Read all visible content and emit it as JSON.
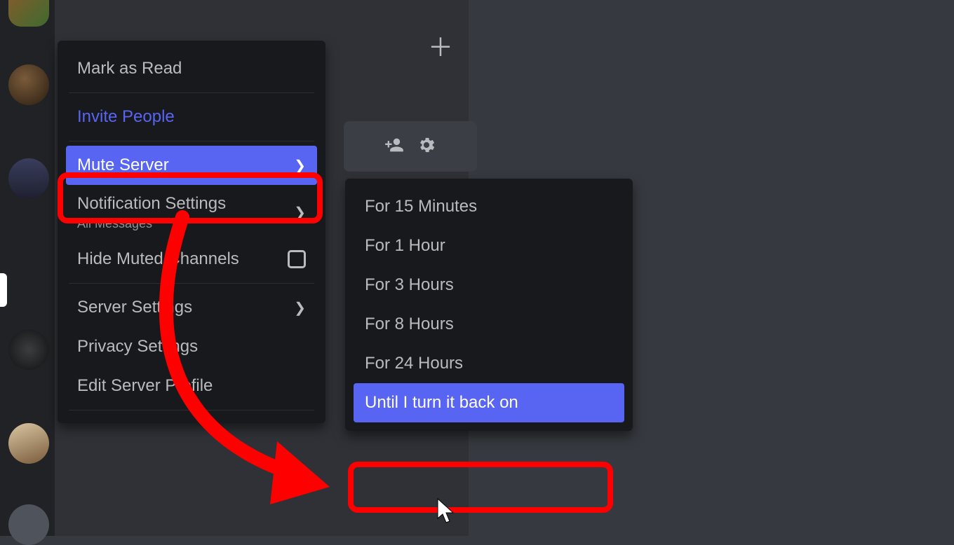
{
  "menu": {
    "mark_as_read": "Mark as Read",
    "invite_people": "Invite People",
    "mute_server": "Mute Server",
    "notification_settings": "Notification Settings",
    "notification_sub": "All Messages",
    "hide_muted_channels": "Hide Muted Channels",
    "server_settings": "Server Settings",
    "privacy_settings": "Privacy Settings",
    "edit_server_profile": "Edit Server Profile"
  },
  "mute_options": {
    "opt_15m": "For 15 Minutes",
    "opt_1h": "For 1 Hour",
    "opt_3h": "For 3 Hours",
    "opt_8h": "For 8 Hours",
    "opt_24h": "For 24 Hours",
    "opt_until": "Until I turn it back on"
  }
}
